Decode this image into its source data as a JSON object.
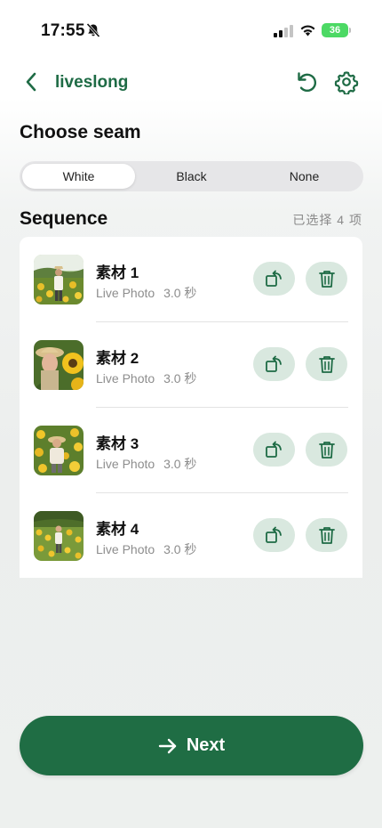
{
  "status_bar": {
    "time": "17:55",
    "battery": "36"
  },
  "nav": {
    "title": "liveslong"
  },
  "seam": {
    "title": "Choose seam",
    "options": [
      "White",
      "Black",
      "None"
    ],
    "selected": "White"
  },
  "sequence": {
    "title": "Sequence",
    "count_label": "已选择 4 项",
    "items": [
      {
        "name": "素材 1",
        "type": "Live Photo",
        "duration": "3.0 秒"
      },
      {
        "name": "素材 2",
        "type": "Live Photo",
        "duration": "3.0 秒"
      },
      {
        "name": "素材 3",
        "type": "Live Photo",
        "duration": "3.0 秒"
      },
      {
        "name": "素材 4",
        "type": "Live Photo",
        "duration": "3.0 秒"
      }
    ]
  },
  "footer": {
    "next_label": "Next"
  },
  "colors": {
    "accent": "#1f6d44",
    "accent_light": "#d9e8df",
    "battery": "#4cd964"
  },
  "icons": [
    "back-icon",
    "reset-icon",
    "gear-icon",
    "rotate-icon",
    "trash-icon",
    "arrow-right-icon",
    "bell-off-icon",
    "signal-icon",
    "wifi-icon"
  ]
}
